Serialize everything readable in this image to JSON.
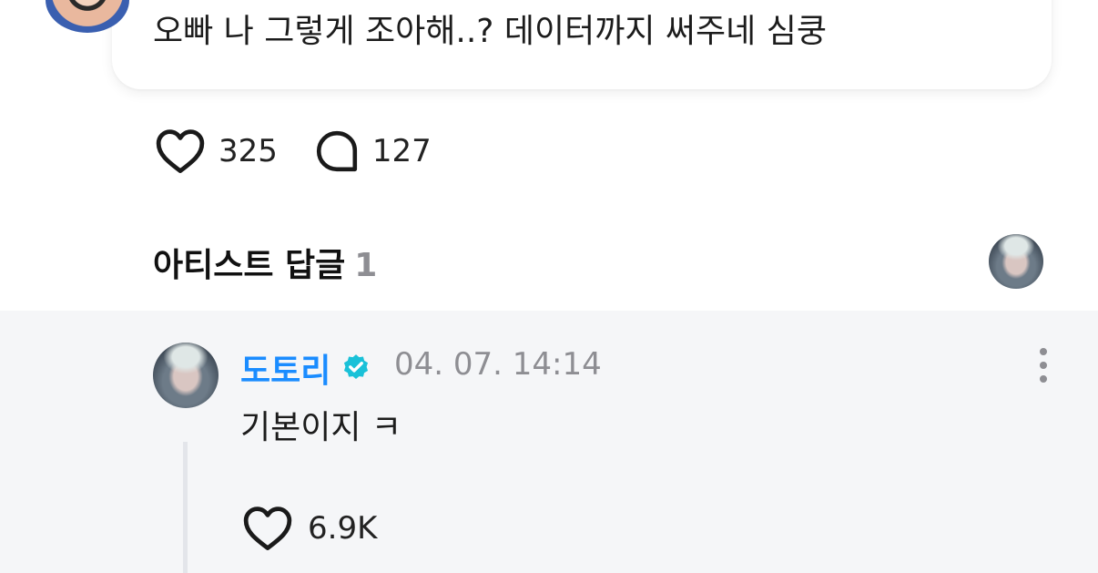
{
  "post": {
    "text": "오빠 나 그렇게 조아해..? 데이터까지 써주네 심쿵",
    "like_count": "325",
    "comment_count": "127",
    "icons": {
      "like": "heart-outline-icon",
      "comment": "speech-bubble-icon"
    }
  },
  "artist_replies": {
    "title": "아티스트 답글",
    "count": "1"
  },
  "reply": {
    "author": "도토리",
    "date": "04. 07. 14:14",
    "text": "기본이지 ㅋ",
    "like_count": "6.9K",
    "accent_color": "#1a8cff",
    "verified_color": "#1ac1d8",
    "icons": {
      "verified": "verified-badge-icon",
      "more": "more-vertical-icon",
      "like": "heart-outline-icon"
    }
  }
}
